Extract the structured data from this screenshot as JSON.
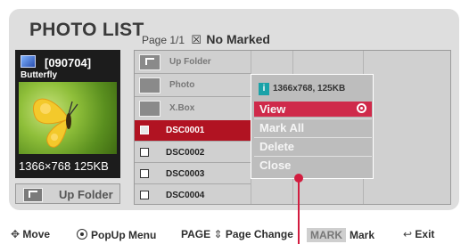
{
  "title": "PHOTO LIST",
  "page_info": {
    "page": "Page 1/1",
    "marked": "No Marked"
  },
  "preview": {
    "name": "[090704]",
    "subtitle": "Butterfly",
    "dimensions": "1366×768 125KB"
  },
  "up_folder_button": "Up Folder",
  "list_items": [
    {
      "kind": "folder-up",
      "label": "Up Folder"
    },
    {
      "kind": "folder",
      "label": "Photo"
    },
    {
      "kind": "folder",
      "label": "X.Box"
    },
    {
      "kind": "file",
      "label": "DSC0001",
      "selected": true
    },
    {
      "kind": "file",
      "label": "DSC0002"
    },
    {
      "kind": "file",
      "label": "DSC0003"
    },
    {
      "kind": "file",
      "label": "DSC0004"
    }
  ],
  "popup": {
    "info_icon": "i",
    "info": "1366x768, 125KB",
    "items": [
      "View",
      "Mark All",
      "Delete",
      "Close"
    ],
    "highlighted": "View"
  },
  "footer": {
    "move": "Move",
    "popup_menu": "PopUp Menu",
    "page": "PAGE",
    "page_change": "Page Change",
    "mark_key": "MARK",
    "mark": "Mark",
    "exit": "Exit"
  },
  "colors": {
    "accent_red": "#b11322",
    "popup_highlight": "#cf2a4a",
    "info_icon": "#1aa2a8"
  }
}
